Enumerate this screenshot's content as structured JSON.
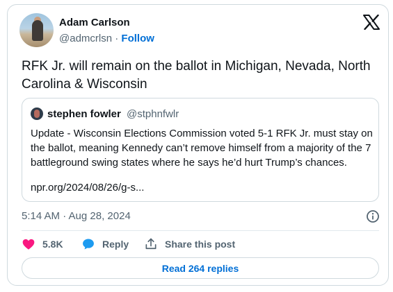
{
  "author": {
    "name": "Adam Carlson",
    "handle": "@admcrlsn",
    "separator": "·",
    "follow_label": "Follow"
  },
  "tweet": {
    "text": "RFK Jr. will remain on the ballot in Michigan, Nevada, North Carolina & Wisconsin",
    "timestamp": "5:14 AM · Aug 28, 2024"
  },
  "quoted_tweet": {
    "name": "stephen fowler",
    "handle": "@stphnfwlr",
    "text": "Update - Wisconsin Elections Commission voted 5-1 RFK Jr. must stay on the ballot, meaning Kennedy can’t remove himself from a majority of the 7 battleground swing states where he says he’d hurt Trump’s chances.",
    "link": "npr.org/2024/08/26/g-s..."
  },
  "actions": {
    "like_count": "5.8K",
    "reply_label": "Reply",
    "share_label": "Share this post"
  },
  "read_replies_label": "Read 264 replies",
  "icons": {
    "logo": "x-logo-icon",
    "info": "info-icon",
    "like": "heart-icon",
    "reply": "speech-bubble-icon",
    "share": "share-upload-icon"
  },
  "colors": {
    "accent": "#006fd6",
    "like": "#f91880",
    "reply": "#1d9bf0",
    "text": "#0f1419",
    "muted": "#536471",
    "border": "#cfd9de"
  }
}
